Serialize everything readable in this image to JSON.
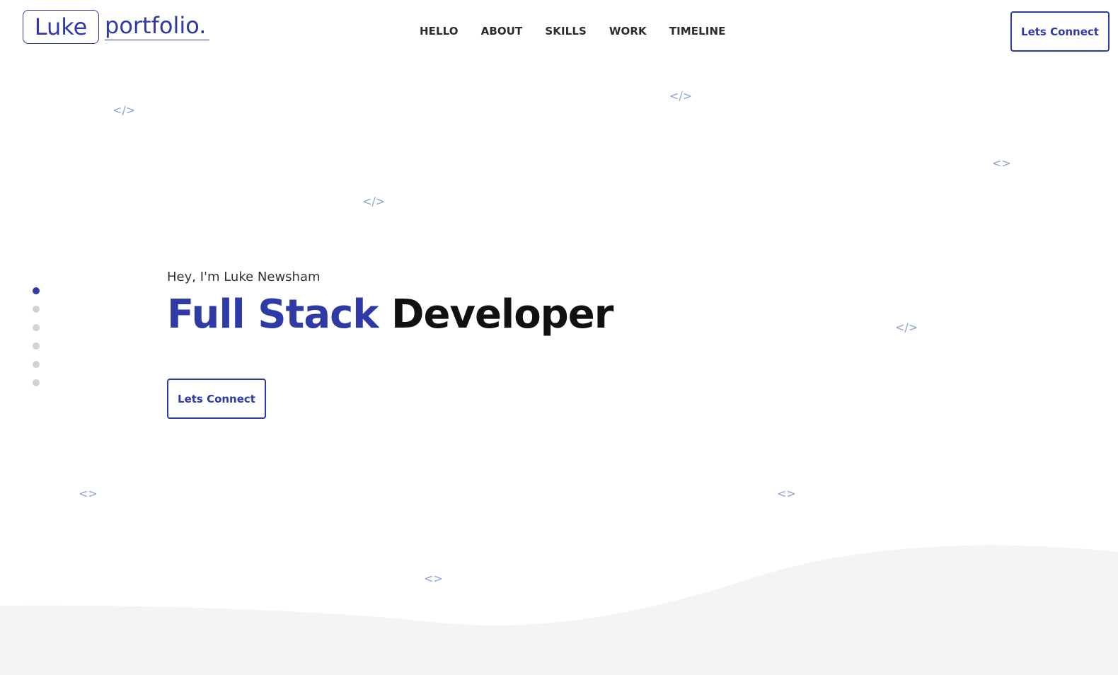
{
  "logo": {
    "boxed": "Luke",
    "text": "portfolio."
  },
  "nav": [
    "HELLO",
    "ABOUT",
    "SKILLS",
    "WORK",
    "TIMELINE"
  ],
  "header": {
    "cta": "Lets Connect"
  },
  "hero": {
    "greeting": "Hey, I'm Luke Newsham",
    "title_accent": "Full Stack",
    "title_rest": "Developer",
    "cta": "Lets Connect"
  },
  "dots": {
    "count": 6,
    "active_index": 0
  },
  "floating_tags": [
    "</>",
    "</>",
    "<>",
    "</>",
    "</>",
    "<>",
    "<>",
    "<>"
  ],
  "colors": {
    "accent": "#2e3aa6",
    "tag": "#8aa0d6",
    "dot_inactive": "#d3d3d3",
    "wave": "#f4f4f4"
  }
}
